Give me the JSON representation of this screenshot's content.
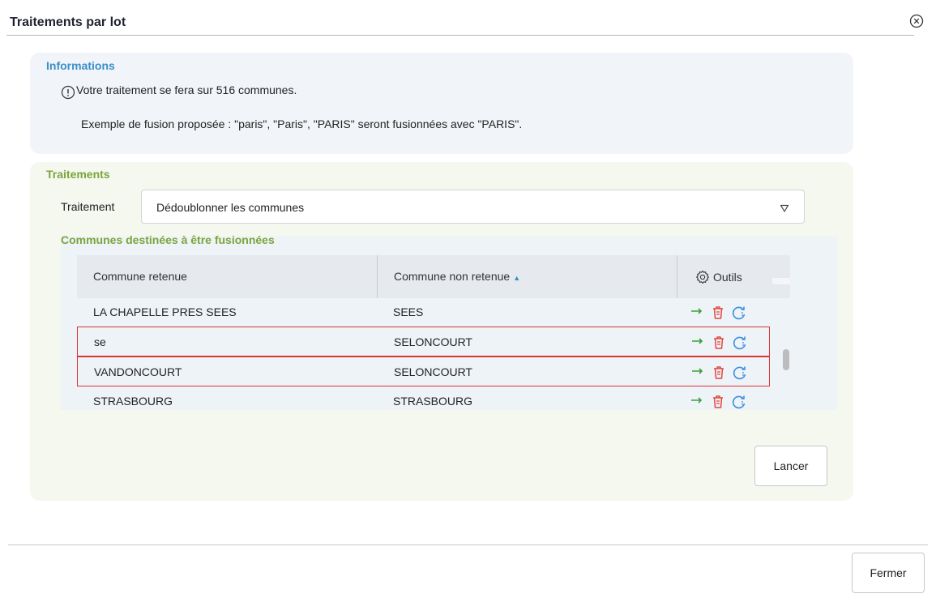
{
  "dialog": {
    "title": "Traitements par lot",
    "close_icon": "close-circle-icon"
  },
  "informations": {
    "title": "Informations",
    "line1": "Votre traitement se fera sur 516 communes.",
    "line2": "Exemple de fusion proposée : \"paris\", \"Paris\", \"PARIS\" seront fusionnées avec \"PARIS\".",
    "icon": "info-circle-icon",
    "color": "#3a8fc8"
  },
  "traitements": {
    "title": "Traitements",
    "select_label": "Traitement",
    "select_value": "Dédoublonner les communes",
    "subtitle": "Communes destinées à être fusionnées",
    "color": "#7aa53a"
  },
  "grid": {
    "columns": [
      {
        "label": "Commune retenue"
      },
      {
        "label": "Commune non retenue",
        "sorted": "asc"
      },
      {
        "label": "Outils"
      }
    ],
    "rows": [
      {
        "retenue": "LA CHAPELLE PRES SEES",
        "non_retenue": "SEES",
        "selected": false
      },
      {
        "retenue": "se",
        "non_retenue": "SELONCOURT",
        "selected": true
      },
      {
        "retenue": "VANDONCOURT",
        "non_retenue": "SELONCOURT",
        "selected": true
      },
      {
        "retenue": "STRASBOURG",
        "non_retenue": "STRASBOURG",
        "selected": false
      }
    ],
    "tool_icons": [
      "merge-arrows-icon",
      "trash-icon",
      "refresh-icon"
    ],
    "colors": {
      "merge": "#3aa03a",
      "delete": "#e2463e",
      "refresh": "#3a8fe0",
      "selection": "#d33333"
    }
  },
  "buttons": {
    "lancer": "Lancer",
    "fermer": "Fermer"
  }
}
